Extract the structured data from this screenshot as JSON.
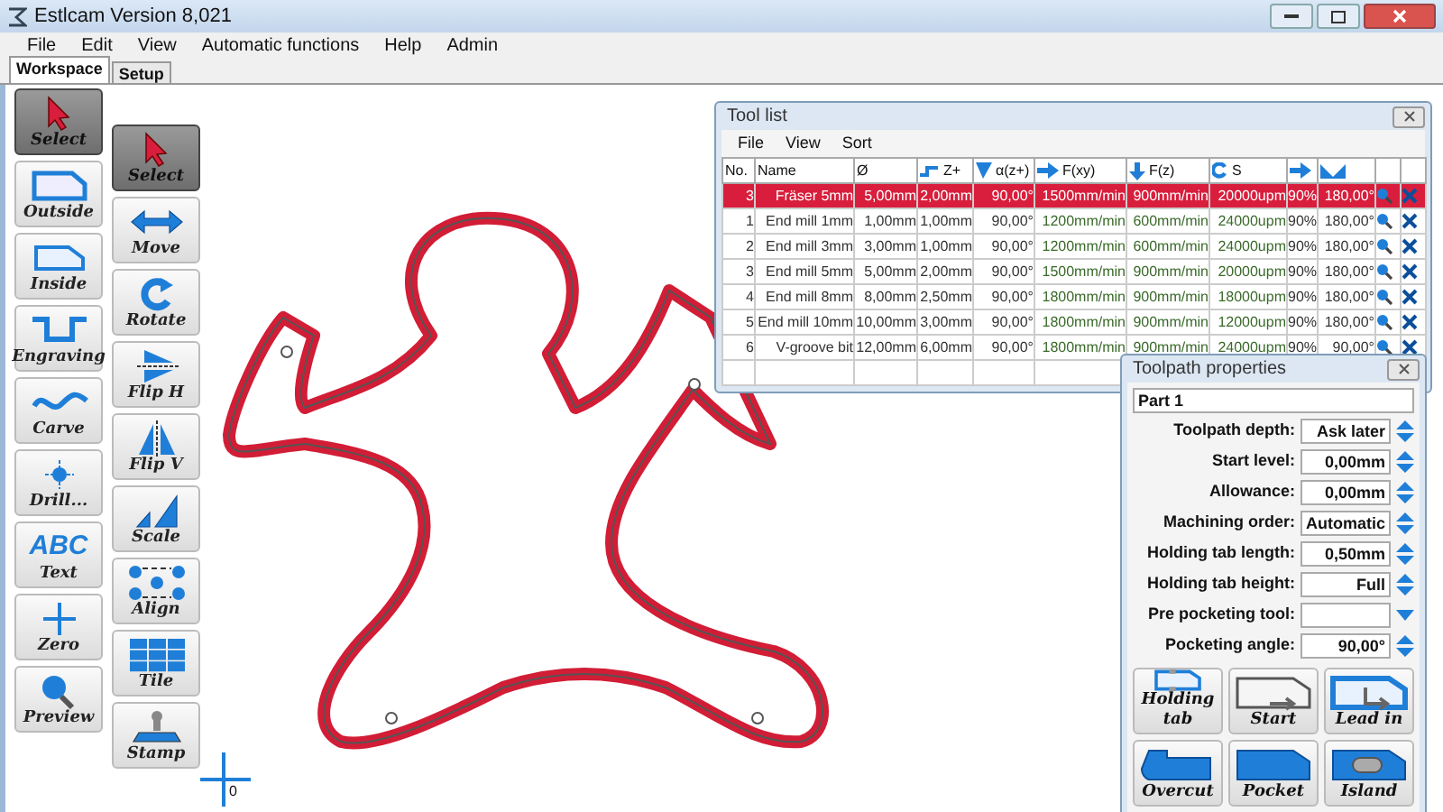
{
  "window": {
    "title": "Estlcam Version 8,021"
  },
  "menu": [
    "File",
    "Edit",
    "View",
    "Automatic functions",
    "Help",
    "Admin"
  ],
  "tabs": [
    {
      "label": "Workspace",
      "selected": true
    },
    {
      "label": "Setup",
      "selected": false
    }
  ],
  "tools_primary": [
    {
      "label": "Select",
      "selected": true
    },
    {
      "label": "Outside",
      "selected": false
    },
    {
      "label": "Inside",
      "selected": false
    },
    {
      "label": "Engraving",
      "selected": false
    },
    {
      "label": "Carve",
      "selected": false
    },
    {
      "label": "Drill...",
      "selected": false
    },
    {
      "label": "Text",
      "selected": false,
      "glyph": "ABC"
    },
    {
      "label": "Zero",
      "selected": false
    },
    {
      "label": "Preview",
      "selected": false
    }
  ],
  "tools_edit": [
    {
      "label": "Select",
      "selected": true
    },
    {
      "label": "Move",
      "selected": false
    },
    {
      "label": "Rotate",
      "selected": false
    },
    {
      "label": "Flip H",
      "selected": false
    },
    {
      "label": "Flip V",
      "selected": false
    },
    {
      "label": "Scale",
      "selected": false
    },
    {
      "label": "Align",
      "selected": false
    },
    {
      "label": "Tile",
      "selected": false
    },
    {
      "label": "Stamp",
      "selected": false
    }
  ],
  "origin_label": "0",
  "tool_list": {
    "title": "Tool list",
    "menu": [
      "File",
      "View",
      "Sort"
    ],
    "columns": [
      "No.",
      "Name",
      "Ø",
      "Z+",
      "α(z+)",
      "F(xy)",
      "F(z)",
      "S"
    ],
    "rows": [
      {
        "selected": true,
        "cells": [
          "3",
          "Fräser 5mm",
          "5,00mm",
          "2,00mm",
          "90,00°",
          "1500mm/min",
          "900mm/min",
          "20000upm",
          "90%",
          "180,00°"
        ]
      },
      {
        "selected": false,
        "cells": [
          "1",
          "End mill 1mm",
          "1,00mm",
          "1,00mm",
          "90,00°",
          "1200mm/min",
          "600mm/min",
          "24000upm",
          "90%",
          "180,00°"
        ]
      },
      {
        "selected": false,
        "cells": [
          "2",
          "End mill 3mm",
          "3,00mm",
          "1,00mm",
          "90,00°",
          "1200mm/min",
          "600mm/min",
          "24000upm",
          "90%",
          "180,00°"
        ]
      },
      {
        "selected": false,
        "cells": [
          "3",
          "End mill 5mm",
          "5,00mm",
          "2,00mm",
          "90,00°",
          "1500mm/min",
          "900mm/min",
          "20000upm",
          "90%",
          "180,00°"
        ]
      },
      {
        "selected": false,
        "cells": [
          "4",
          "End mill 8mm",
          "8,00mm",
          "2,50mm",
          "90,00°",
          "1800mm/min",
          "900mm/min",
          "18000upm",
          "90%",
          "180,00°"
        ]
      },
      {
        "selected": false,
        "cells": [
          "5",
          "End mill 10mm",
          "10,00mm",
          "3,00mm",
          "90,00°",
          "1800mm/min",
          "900mm/min",
          "12000upm",
          "90%",
          "180,00°"
        ]
      },
      {
        "selected": false,
        "cells": [
          "6",
          "V-groove bit",
          "12,00mm",
          "6,00mm",
          "90,00°",
          "1800mm/min",
          "900mm/min",
          "24000upm",
          "90%",
          "90,00°"
        ]
      }
    ]
  },
  "toolpath_properties": {
    "title": "Toolpath properties",
    "name": "Part 1",
    "fields": [
      {
        "label": "Toolpath depth:",
        "value": "Ask later",
        "kind": "spinner"
      },
      {
        "label": "Start level:",
        "value": "0,00mm",
        "kind": "spinner"
      },
      {
        "label": "Allowance:",
        "value": "0,00mm",
        "kind": "spinner"
      },
      {
        "label": "Machining order:",
        "value": "Automatic",
        "kind": "spinner"
      },
      {
        "label": "Holding tab length:",
        "value": "0,50mm",
        "kind": "spinner"
      },
      {
        "label": "Holding tab height:",
        "value": "Full",
        "kind": "spinner"
      },
      {
        "label": "Pre pocketing tool:",
        "kind": "dropdown"
      },
      {
        "label": "Pocketing angle:",
        "value": "90,00°",
        "kind": "spinner"
      }
    ],
    "buttons": [
      "Holding tab",
      "Start",
      "Lead in",
      "Overcut",
      "Pocket",
      "Island"
    ]
  }
}
